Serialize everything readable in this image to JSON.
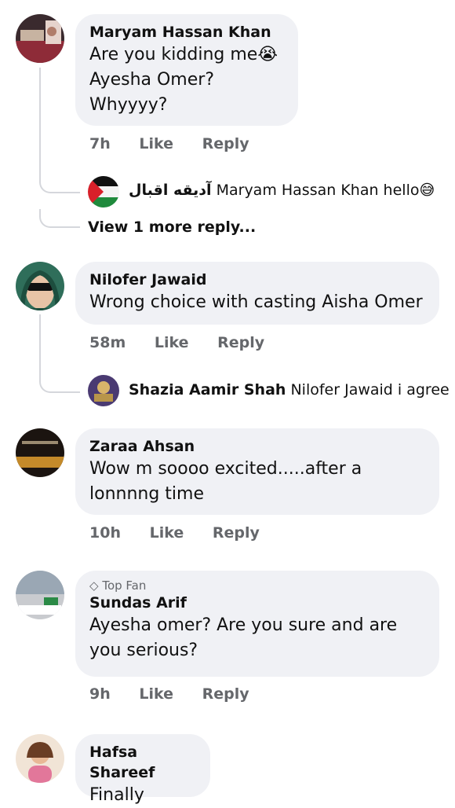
{
  "comments": [
    {
      "name": "Maryam Hassan Khan",
      "lines": [
        "Are you kidding me😭",
        "Ayesha Omer?",
        "Whyyyy?"
      ],
      "time": "7h",
      "like": "Like",
      "reply": "Reply",
      "sub_reply": {
        "name": "آديقه اقبال",
        "text": "Maryam Hassan Khan hello😅"
      },
      "view_more": "View 1 more reply..."
    },
    {
      "name": "Nilofer Jawaid",
      "lines": [
        "Wrong choice with casting Aisha Omer"
      ],
      "time": "58m",
      "like": "Like",
      "reply": "Reply",
      "sub_reply": {
        "name": "Shazia Aamir Shah",
        "text": "Nilofer Jawaid i agree"
      }
    },
    {
      "name": "Zaraa Ahsan",
      "lines": [
        "Wow m soooo excited.....after a",
        "lonnnng time"
      ],
      "time": "10h",
      "like": "Like",
      "reply": "Reply"
    },
    {
      "badge": "Top Fan",
      "name": "Sundas Arif",
      "lines": [
        "Ayesha omer? Are you sure and are",
        "you serious?"
      ],
      "time": "9h",
      "like": "Like",
      "reply": "Reply"
    },
    {
      "name": "Hafsa Shareef",
      "lines": [
        "Finally"
      ]
    }
  ],
  "icons": {
    "top_fan": "diamond-icon"
  },
  "colors": {
    "bubble": "#f0f1f5",
    "meta": "#65676b",
    "thread": "#d5d7dc"
  }
}
